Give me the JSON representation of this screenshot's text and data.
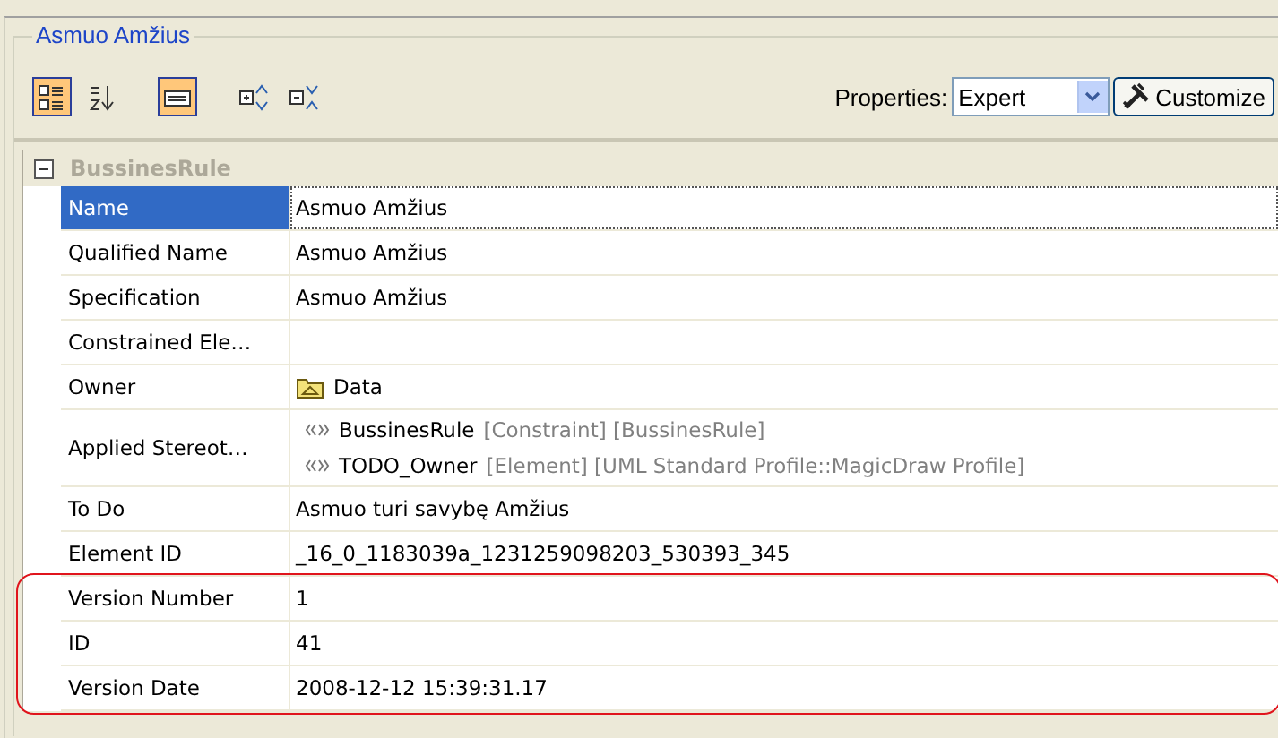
{
  "panel": {
    "title": "Asmuo Amžius"
  },
  "toolbar": {
    "buttons": [
      {
        "kind": "categorized",
        "selected": true
      },
      {
        "kind": "alphabetical",
        "selected": false
      },
      {
        "kind": "description",
        "selected": true
      },
      {
        "kind": "expand",
        "selected": false
      },
      {
        "kind": "collapse",
        "selected": false
      }
    ],
    "properties_label": "Properties:",
    "properties_value": "Expert",
    "customize": "Customize"
  },
  "category": {
    "label": "BussinesRule",
    "expanded": true
  },
  "rows": [
    {
      "kind": "text",
      "label": "Name",
      "value": "Asmuo Amžius",
      "selected": true
    },
    {
      "kind": "text",
      "label": "Qualified Name",
      "value": "Asmuo Amžius",
      "selected": false
    },
    {
      "kind": "text",
      "label": "Specification",
      "value": "Asmuo Amžius",
      "selected": false
    },
    {
      "kind": "text",
      "label": "Constrained Ele…",
      "selected": false
    },
    {
      "kind": "element",
      "label": "Owner",
      "value": "Data",
      "selected": false
    },
    {
      "kind": "stereotypes",
      "label": "Applied Stereot…",
      "selected": false,
      "items": [
        {
          "name": "BussinesRule",
          "details": "[Constraint] [BussinesRule]"
        },
        {
          "name": "TODO_Owner",
          "details": "[Element] [UML Standard Profile::MagicDraw Profile]"
        }
      ]
    },
    {
      "kind": "text",
      "label": "To Do",
      "value": "Asmuo turi savybę Amžius",
      "selected": false
    },
    {
      "kind": "text",
      "label": "Element ID",
      "value": "_16_0_1183039a_1231259098203_530393_345",
      "selected": false
    },
    {
      "kind": "text",
      "label": "Version Number",
      "value": "1",
      "selected": false,
      "highlighted": true
    },
    {
      "kind": "text",
      "label": "ID",
      "value": "41",
      "selected": false,
      "highlighted": true
    },
    {
      "kind": "text",
      "label": "Version Date",
      "value": "2008-12-12 15:39:31.17",
      "selected": false,
      "highlighted": true
    }
  ]
}
